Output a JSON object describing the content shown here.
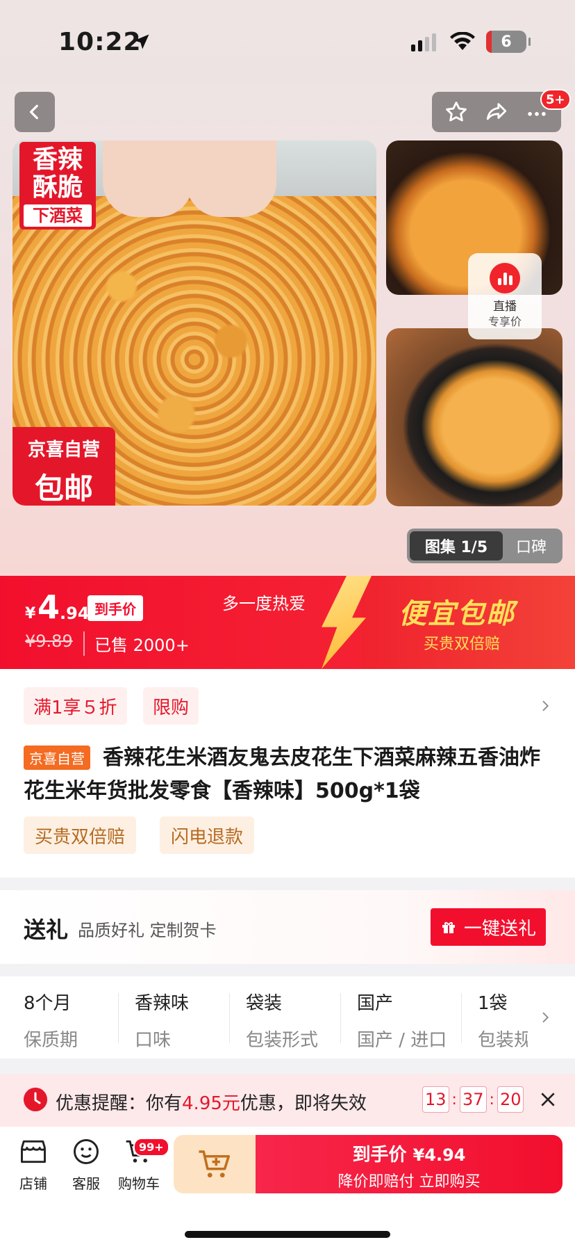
{
  "status": {
    "time": "10:22",
    "battery": "6"
  },
  "nav": {
    "cart_count": "5+"
  },
  "hero": {
    "tag_flavor": [
      "香辣",
      "酥脆",
      "下酒菜"
    ],
    "tag_jd": [
      "京喜自营",
      "包邮"
    ],
    "live": [
      "直播",
      "专享价"
    ],
    "gallery_active": "图集 1/5",
    "gallery_other": "口碑"
  },
  "price": {
    "currency": "¥",
    "int": "4",
    "dec": ".94",
    "tag": "到手价",
    "old": "¥9.89",
    "sold": "已售 2000+",
    "slogan": "多一度热爱",
    "promo_title": "便宜包邮",
    "promo_sub": "买贵双倍赔"
  },
  "info": {
    "coupons": [
      "满1享５折",
      "限购"
    ],
    "jd_badge": "京喜自营",
    "title": "香辣花生米酒友鬼去皮花生下酒菜麻辣五香油炸花生米年货批发零食【香辣味】500g*1袋",
    "services": [
      "买贵双倍赔",
      "闪电退款"
    ]
  },
  "gift": {
    "title": "送礼",
    "desc": "品质好礼 定制贺卡",
    "button": "一键送礼"
  },
  "specs": [
    {
      "value": "8个月",
      "key": "保质期"
    },
    {
      "value": "香辣味",
      "key": "口味"
    },
    {
      "value": "袋装",
      "key": "包装形式"
    },
    {
      "value": "国产",
      "key": "国产 / 进口"
    },
    {
      "value": "1袋",
      "key": "包装规"
    }
  ],
  "reminder": {
    "prefix": "优惠提醒：你有",
    "amount": "4.95元",
    "suffix": "优惠，即将失效",
    "h": "13",
    "m": "37",
    "s": "20",
    "sep": ":"
  },
  "bottom": {
    "shop": "店铺",
    "service": "客服",
    "cart": "购物车",
    "cart_badge": "99+",
    "buy_line1": "到手价",
    "buy_price": "¥4.94",
    "buy_line2": "降价即赔付 立即购买"
  },
  "colors": {
    "brand_red": "#f20f2d",
    "accent_yellow": "#ffe05a",
    "jd_orange": "#f46b21"
  }
}
